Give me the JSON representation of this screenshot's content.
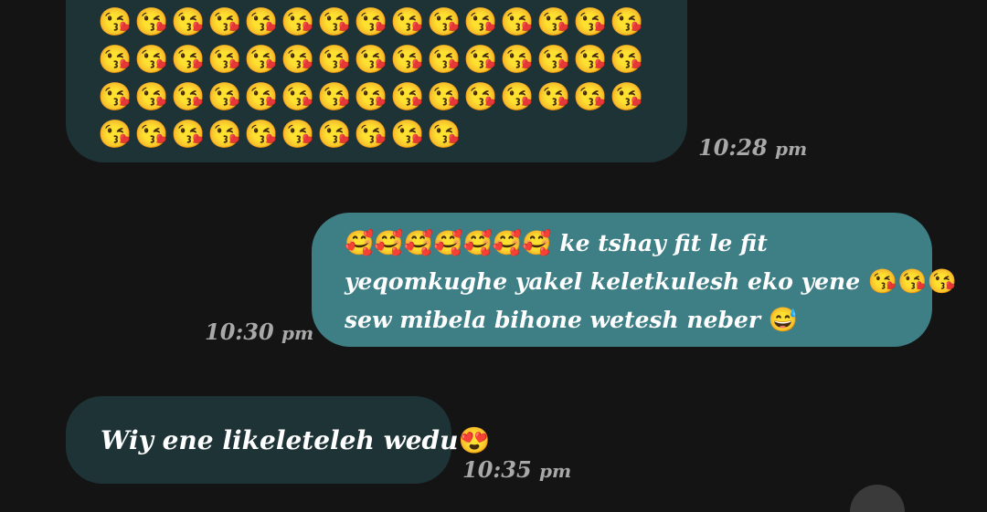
{
  "messages": [
    {
      "direction": "incoming",
      "emoji_rows": [
        "😘😘😘😘😘😘😘😘😘😘😘😘😘😘😘",
        "😘😘😘😘😘😘😘😘😘😘😘😘😘😘😘",
        "😘😘😘😘😘😘😘😘😘😘😘😘😘😘😘",
        "😘😘😘😘😘😘😘😘😘😘"
      ],
      "time": "10:28",
      "ampm": "pm"
    },
    {
      "direction": "outgoing",
      "line1_emoji": "🥰🥰🥰🥰🥰🥰🥰",
      "line1_text": " ke tshay fit le fit",
      "line2_text": "yeqomkughe yakel keletkulesh eko yene ",
      "line2_emoji": "😘😘😘",
      "line3_text": "sew mibela bihone wetesh neber ",
      "line3_emoji": "😅",
      "time": "10:30",
      "ampm": "pm"
    },
    {
      "direction": "incoming",
      "text": "Wiy ene likeleteleh wedu",
      "emoji": "😍",
      "time": "10:35",
      "ampm": "pm"
    }
  ],
  "colors": {
    "background": "#141414",
    "incoming_bubble": "#1d3336",
    "outgoing_bubble": "#3e7f86",
    "timestamp": "#a8a8a8"
  }
}
